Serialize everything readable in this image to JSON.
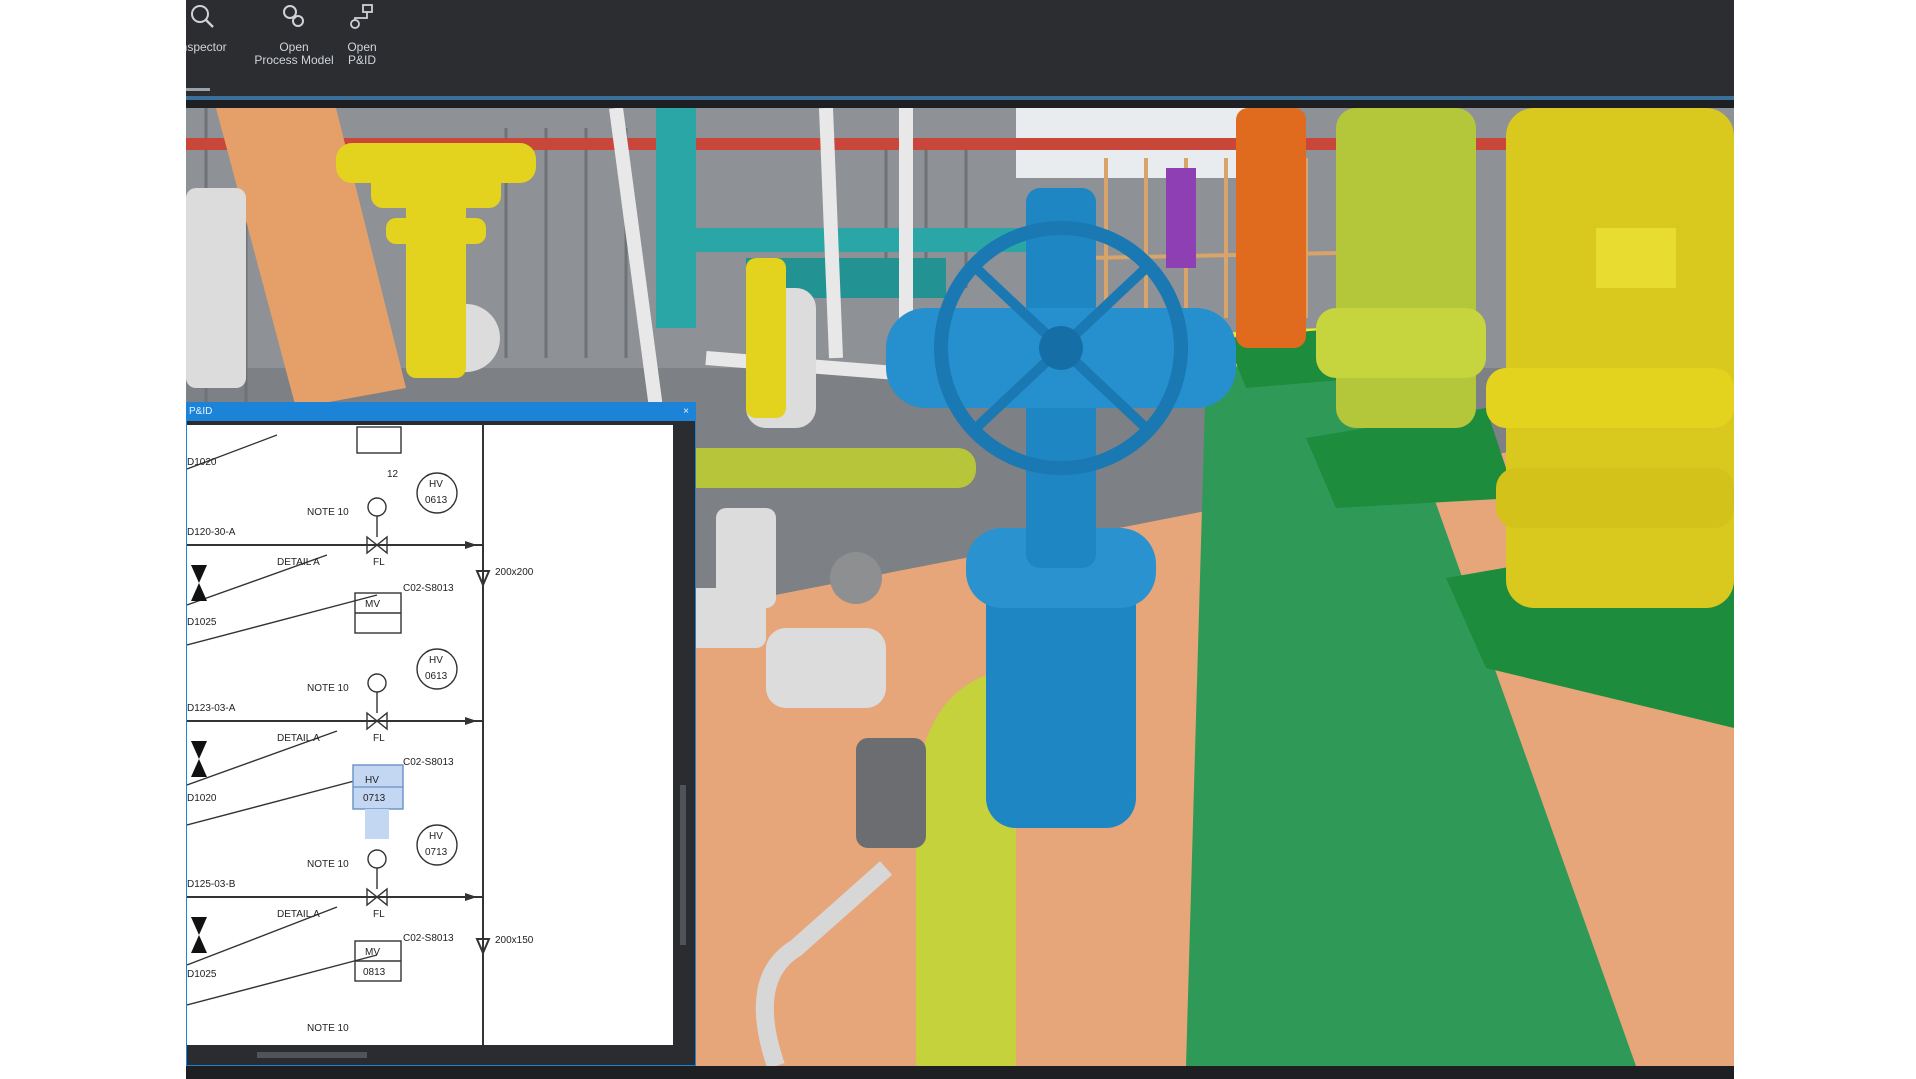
{
  "ribbon": {
    "buttons": [
      {
        "id": "inspector",
        "label": "Inspector",
        "icon": "search-icon"
      },
      {
        "id": "process",
        "label": "Open\nProcess Model",
        "icon": "link-icon"
      },
      {
        "id": "pid",
        "label": "Open\nP&ID",
        "icon": "diagram-icon"
      }
    ]
  },
  "pid_panel": {
    "title": "P&ID",
    "close_glyph": "×",
    "labels": {
      "note": "NOTE 10",
      "detail": "DETAIL A",
      "fl": "FL",
      "hv": "HV",
      "mv": "MV",
      "tag_0613": "0613",
      "tag_0713": "0713",
      "tag_0813": "0813",
      "line_1": "D120-30-A",
      "line_2": "D123-03-A",
      "line_3": "D125-03-B",
      "ref_1": "D1020",
      "ref_2": "D1025",
      "ref_3": "D1020",
      "ref_4": "D1025",
      "size_1": "200x200",
      "size_2": "200x150",
      "c_1": "C02-S8013",
      "c_2": "C02-S8013",
      "c_3": "C02-S8013",
      "t12": "12"
    }
  },
  "colors": {
    "accent": "#1b84d8",
    "valve_blue": "#1f86c4",
    "pipe_yellow_green": "#c4d33d",
    "floor_green": "#2e9b5a",
    "floor_orange": "#e8a877"
  }
}
